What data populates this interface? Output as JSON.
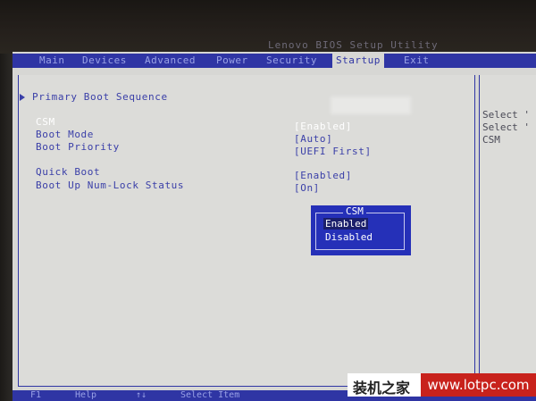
{
  "window": {
    "title": "Lenovo BIOS Setup Utility"
  },
  "menu": {
    "items": [
      "Main",
      "Devices",
      "Advanced",
      "Power",
      "Security",
      "Startup",
      "Exit"
    ],
    "active": "Startup"
  },
  "startup": {
    "primary_boot_sequence": "Primary Boot Sequence",
    "settings": [
      {
        "label": "CSM",
        "value": "[Enabled]"
      },
      {
        "label": "Boot Mode",
        "value": "[Auto]"
      },
      {
        "label": "Boot Priority",
        "value": "[UEFI First]"
      },
      {
        "label": "Quick Boot",
        "value": "[Enabled]"
      },
      {
        "label": "Boot Up Num-Lock Status",
        "value": "[On]"
      }
    ]
  },
  "help": {
    "lines": [
      "Select '",
      "Select '",
      "CSM"
    ]
  },
  "popup": {
    "title": "CSM",
    "options": [
      "Enabled",
      "Disabled"
    ],
    "selected": "Enabled"
  },
  "bottom": {
    "items": [
      "F1",
      "Help",
      "↑↓",
      "Select Item"
    ]
  },
  "watermark": {
    "cn": "装机之家",
    "url": "www.lotpc.com"
  },
  "colors": {
    "bios_blue": "#2f35a4",
    "bios_bg": "#d7d7d4",
    "popup_blue": "#2530b8",
    "watermark_red": "#c8221c"
  }
}
